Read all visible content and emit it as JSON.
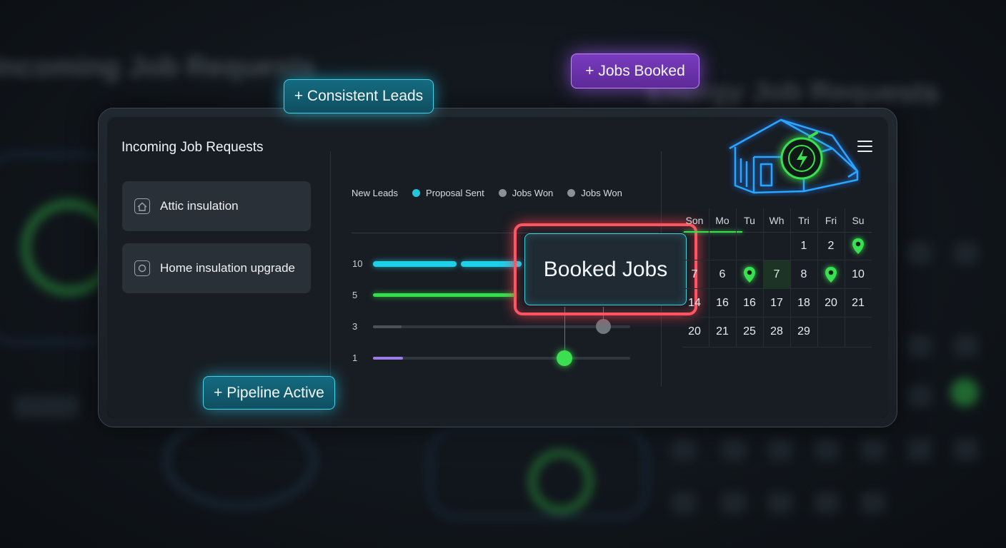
{
  "background": {
    "left_title": "Incoming Job Requests",
    "right_title": "Energy Job Requests"
  },
  "panel": {
    "title": "Incoming Job Requests",
    "jobs": [
      {
        "label": "Attic insulation",
        "icon": "house-icon"
      },
      {
        "label": "Home insulation upgrade",
        "icon": "circle-icon"
      }
    ]
  },
  "legend": [
    {
      "label": "New Leads",
      "color": ""
    },
    {
      "label": "Proposal Sent",
      "color": "#22c6de"
    },
    {
      "label": "Jobs Won",
      "color": "#8a9098"
    },
    {
      "label": "Jobs Won",
      "color": "#8a9098"
    }
  ],
  "pipeline_rows": [
    {
      "label": "10",
      "color": "#1fd0e8",
      "level": 0.55
    },
    {
      "label": "5",
      "color": "#34e04a",
      "level": 0.55
    },
    {
      "label": "3",
      "color": "#4a525a",
      "level": 0.11,
      "knob": 0.9
    },
    {
      "label": "1",
      "color": "#9a7be8",
      "level": 0.12,
      "knob": 0.74
    }
  ],
  "callout": {
    "label": "Booked Jobs"
  },
  "calendar": {
    "days": [
      "Son",
      "Mo",
      "Tu",
      "Wh",
      "Tri",
      "Fri",
      "Su"
    ],
    "weeks": [
      [
        "",
        "",
        "",
        "",
        "1",
        "2",
        "@pin"
      ],
      [
        "7",
        "6",
        "@pin",
        "7",
        "8",
        "@pin",
        "10"
      ],
      [
        "14",
        "16",
        "16",
        "17",
        "18",
        "20",
        "21"
      ],
      [
        "20",
        "21",
        "25",
        "28",
        "29",
        "",
        ""
      ]
    ],
    "accent": "#39e04f"
  },
  "tags": {
    "consistent_leads": "+ Consistent Leads",
    "jobs_booked": "+ Jobs Booked",
    "pipeline_active": "+ Pipeline Active"
  },
  "colors": {
    "cyan": "#41d3ea",
    "purple": "#b57cff",
    "red": "#ff5561",
    "green": "#39e04f"
  }
}
